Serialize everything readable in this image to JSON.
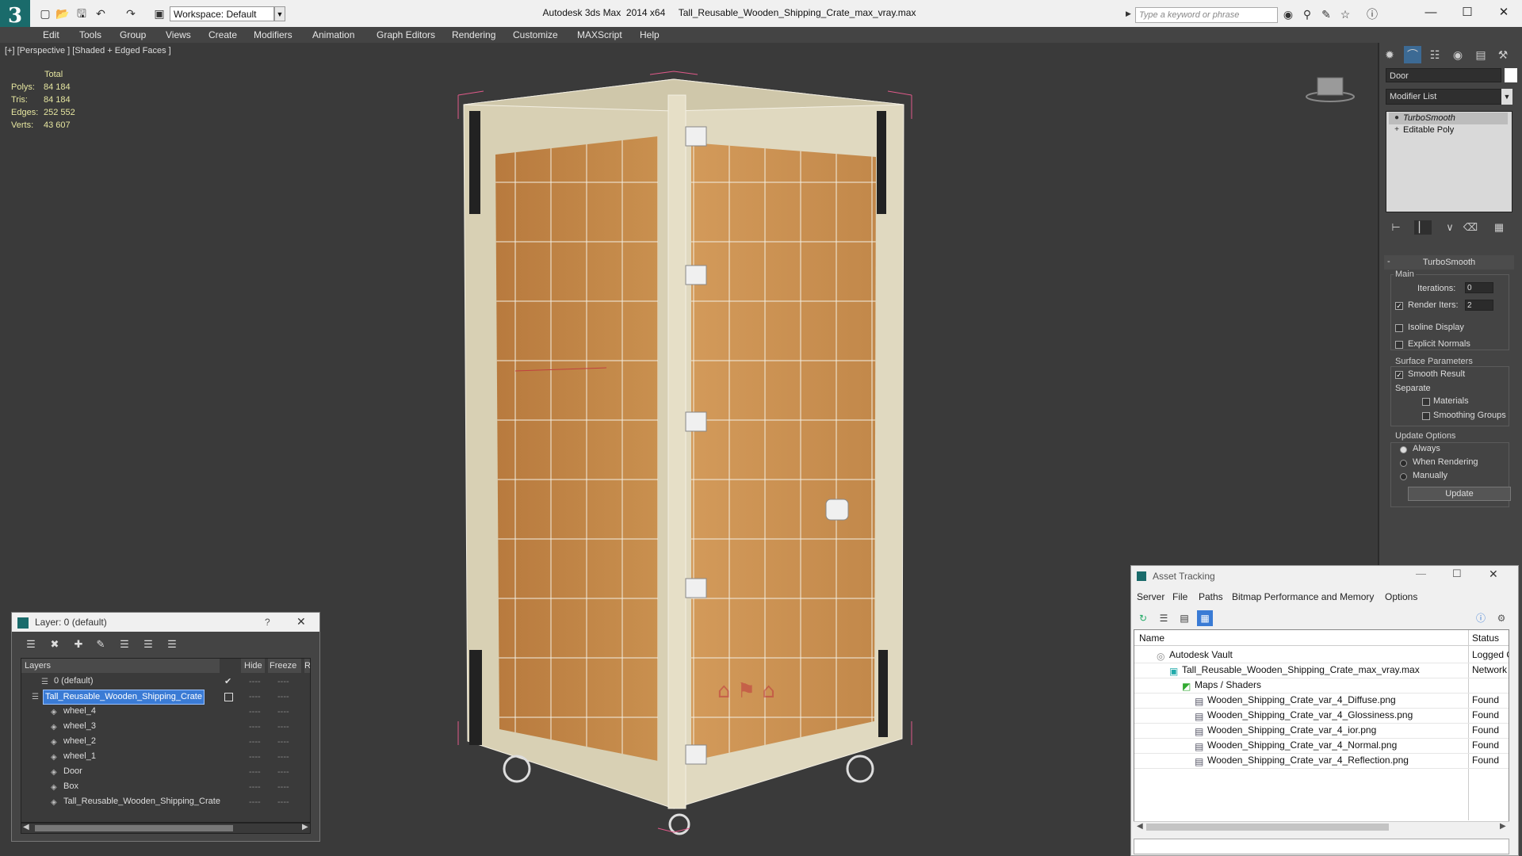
{
  "app": {
    "title": "Autodesk 3ds Max  2014 x64     Tall_Reusable_Wooden_Shipping_Crate_max_vray.max",
    "workspace": "Workspace: Default",
    "search_placeholder": "Type a keyword or phrase"
  },
  "menu": [
    "Edit",
    "Tools",
    "Group",
    "Views",
    "Create",
    "Modifiers",
    "Animation",
    "Graph Editors",
    "Rendering",
    "Customize",
    "MAXScript",
    "Help"
  ],
  "viewport": {
    "label": "[+] [Perspective ] [Shaded + Edged Faces ]",
    "stats": {
      "header": "Total",
      "rows": [
        {
          "label": "Polys:",
          "value": "84 184"
        },
        {
          "label": "Tris:",
          "value": "84 184"
        },
        {
          "label": "Edges:",
          "value": "252 552"
        },
        {
          "label": "Verts:",
          "value": "43 607"
        }
      ]
    }
  },
  "command_panel": {
    "object_name": "Door",
    "modifier_list": "Modifier List",
    "stack": [
      "TurboSmooth",
      "Editable Poly"
    ],
    "rollout": "TurboSmooth",
    "main_label": "Main",
    "iterations_label": "Iterations:",
    "iterations_value": "0",
    "render_iters_label": "Render Iters:",
    "render_iters_value": "2",
    "render_iters_checked": true,
    "isoline_label": "Isoline Display",
    "explicit_label": "Explicit Normals",
    "surface_label": "Surface Parameters",
    "smooth_label": "Smooth Result",
    "separate_label": "Separate",
    "materials_label": "Materials",
    "smoothing_label": "Smoothing Groups",
    "update_options_label": "Update Options",
    "always_label": "Always",
    "when_rendering_label": "When Rendering",
    "manually_label": "Manually",
    "update_button": "Update"
  },
  "layer_dialog": {
    "title": "Layer: 0 (default)",
    "help": "?",
    "columns": [
      "Layers",
      "Hide",
      "Freeze",
      "R"
    ],
    "rows": [
      {
        "name": "0 (default)",
        "selected": false,
        "indent": 1
      },
      {
        "name": "Tall_Reusable_Wooden_Shipping_Crate",
        "selected": true,
        "indent": 0
      },
      {
        "name": "wheel_4",
        "selected": false,
        "indent": 2
      },
      {
        "name": "wheel_3",
        "selected": false,
        "indent": 2
      },
      {
        "name": "wheel_2",
        "selected": false,
        "indent": 2
      },
      {
        "name": "wheel_1",
        "selected": false,
        "indent": 2
      },
      {
        "name": "Door",
        "selected": false,
        "indent": 2
      },
      {
        "name": "Box",
        "selected": false,
        "indent": 2
      },
      {
        "name": "Tall_Reusable_Wooden_Shipping_Crate",
        "selected": false,
        "indent": 2
      }
    ],
    "dash": "----"
  },
  "asset_tracking": {
    "title": "Asset Tracking",
    "menu": [
      "Server",
      "File",
      "Paths",
      "Bitmap Performance and Memory",
      "Options"
    ],
    "columns": [
      "Name",
      "Status"
    ],
    "rows": [
      {
        "name": "Autodesk Vault",
        "status": "Logged O",
        "indent": 0,
        "icon": "vault-icon"
      },
      {
        "name": "Tall_Reusable_Wooden_Shipping_Crate_max_vray.max",
        "status": "Network",
        "indent": 1,
        "icon": "max-file-icon"
      },
      {
        "name": "Maps / Shaders",
        "status": "",
        "indent": 2,
        "icon": "maps-icon"
      },
      {
        "name": "Wooden_Shipping_Crate_var_4_Diffuse.png",
        "status": "Found",
        "indent": 3,
        "icon": "image-file-icon"
      },
      {
        "name": "Wooden_Shipping_Crate_var_4_Glossiness.png",
        "status": "Found",
        "indent": 3,
        "icon": "image-file-icon"
      },
      {
        "name": "Wooden_Shipping_Crate_var_4_ior.png",
        "status": "Found",
        "indent": 3,
        "icon": "image-file-icon"
      },
      {
        "name": "Wooden_Shipping_Crate_var_4_Normal.png",
        "status": "Found",
        "indent": 3,
        "icon": "image-file-icon"
      },
      {
        "name": "Wooden_Shipping_Crate_var_4_Reflection.png",
        "status": "Found",
        "indent": 3,
        "icon": "image-file-icon"
      }
    ]
  },
  "colors": {
    "selection": "#3a7bd5",
    "stats_text": "#e6e6a0",
    "wood": "#c8914f",
    "frame": "#ddd5b8"
  }
}
